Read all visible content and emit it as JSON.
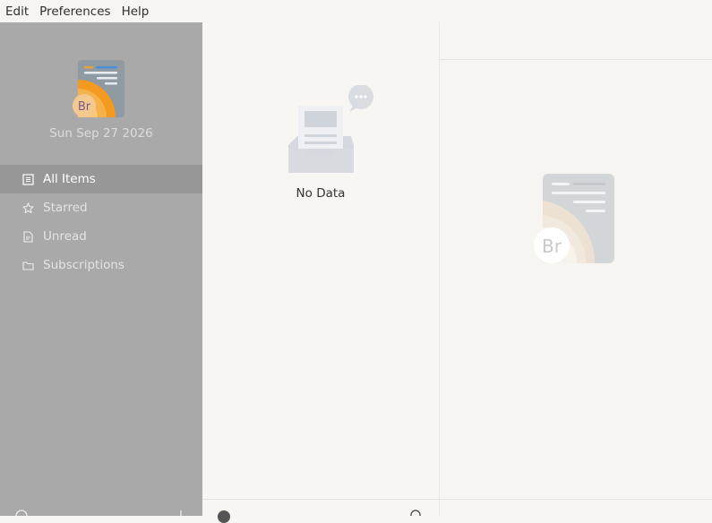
{
  "menubar": {
    "items": [
      "Edit",
      "Preferences",
      "Help"
    ]
  },
  "sidebar": {
    "logo_text": "Br",
    "date": "Sun Sep 27 2026",
    "items": [
      {
        "label": "All Items",
        "icon": "list-icon",
        "active": true
      },
      {
        "label": "Starred",
        "icon": "star-icon",
        "active": false
      },
      {
        "label": "Unread",
        "icon": "document-icon",
        "active": false
      },
      {
        "label": "Subscriptions",
        "icon": "folder-icon",
        "active": false
      }
    ]
  },
  "list": {
    "empty_text": "No Data"
  },
  "article": {
    "logo_text": "Br"
  },
  "colors": {
    "sidebar_bg": "#a9a9a9",
    "sidebar_active": "#979797",
    "accent_orange": "#f5a623",
    "accent_blue": "#4a90d9"
  }
}
